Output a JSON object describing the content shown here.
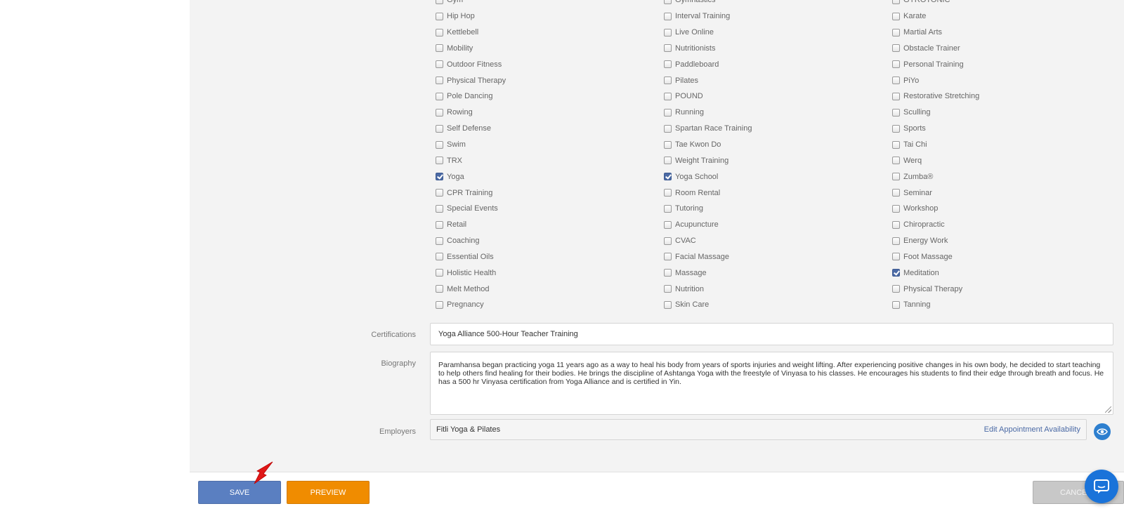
{
  "activities": [
    [
      {
        "label": "Gym",
        "checked": false
      },
      {
        "label": "Gymnastics",
        "checked": false
      },
      {
        "label": "GYROTONIC",
        "checked": false
      }
    ],
    [
      {
        "label": "Hip Hop",
        "checked": false
      },
      {
        "label": "Interval Training",
        "checked": false
      },
      {
        "label": "Karate",
        "checked": false
      }
    ],
    [
      {
        "label": "Kettlebell",
        "checked": false
      },
      {
        "label": "Live Online",
        "checked": false
      },
      {
        "label": "Martial Arts",
        "checked": false
      }
    ],
    [
      {
        "label": "Mobility",
        "checked": false
      },
      {
        "label": "Nutritionists",
        "checked": false
      },
      {
        "label": "Obstacle Trainer",
        "checked": false
      }
    ],
    [
      {
        "label": "Outdoor Fitness",
        "checked": false
      },
      {
        "label": "Paddleboard",
        "checked": false
      },
      {
        "label": "Personal Training",
        "checked": false
      }
    ],
    [
      {
        "label": "Physical Therapy",
        "checked": false
      },
      {
        "label": "Pilates",
        "checked": false
      },
      {
        "label": "PiYo",
        "checked": false
      }
    ],
    [
      {
        "label": "Pole Dancing",
        "checked": false
      },
      {
        "label": "POUND",
        "checked": false
      },
      {
        "label": "Restorative Stretching",
        "checked": false
      }
    ],
    [
      {
        "label": "Rowing",
        "checked": false
      },
      {
        "label": "Running",
        "checked": false
      },
      {
        "label": "Sculling",
        "checked": false
      }
    ],
    [
      {
        "label": "Self Defense",
        "checked": false
      },
      {
        "label": "Spartan Race Training",
        "checked": false
      },
      {
        "label": "Sports",
        "checked": false
      }
    ],
    [
      {
        "label": "Swim",
        "checked": false
      },
      {
        "label": "Tae Kwon Do",
        "checked": false
      },
      {
        "label": "Tai Chi",
        "checked": false
      }
    ],
    [
      {
        "label": "TRX",
        "checked": false
      },
      {
        "label": "Weight Training",
        "checked": false
      },
      {
        "label": "Werq",
        "checked": false
      }
    ],
    [
      {
        "label": "Yoga",
        "checked": true
      },
      {
        "label": "Yoga School",
        "checked": true
      },
      {
        "label": "Zumba®",
        "checked": false
      }
    ],
    [
      {
        "label": "CPR Training",
        "checked": false
      },
      {
        "label": "Room Rental",
        "checked": false
      },
      {
        "label": "Seminar",
        "checked": false
      }
    ],
    [
      {
        "label": "Special Events",
        "checked": false
      },
      {
        "label": "Tutoring",
        "checked": false
      },
      {
        "label": "Workshop",
        "checked": false
      }
    ],
    [
      {
        "label": "Retail",
        "checked": false
      },
      {
        "label": "Acupuncture",
        "checked": false
      },
      {
        "label": "Chiropractic",
        "checked": false
      }
    ],
    [
      {
        "label": "Coaching",
        "checked": false
      },
      {
        "label": "CVAC",
        "checked": false
      },
      {
        "label": "Energy Work",
        "checked": false
      }
    ],
    [
      {
        "label": "Essential Oils",
        "checked": false
      },
      {
        "label": "Facial Massage",
        "checked": false
      },
      {
        "label": "Foot Massage",
        "checked": false
      }
    ],
    [
      {
        "label": "Holistic Health",
        "checked": false
      },
      {
        "label": "Massage",
        "checked": false
      },
      {
        "label": "Meditation",
        "checked": true
      }
    ],
    [
      {
        "label": "Melt Method",
        "checked": false
      },
      {
        "label": "Nutrition",
        "checked": false
      },
      {
        "label": "Physical Therapy",
        "checked": false
      }
    ],
    [
      {
        "label": "Pregnancy",
        "checked": false
      },
      {
        "label": "Skin Care",
        "checked": false
      },
      {
        "label": "Tanning",
        "checked": false
      }
    ]
  ],
  "certifications": {
    "label": "Certifications",
    "value": "Yoga Alliance 500-Hour Teacher Training"
  },
  "biography": {
    "label": "Biography",
    "value": "Paramhansa began practicing yoga 11 years ago as a way to heal his body from years of sports injuries and weight lifting. After experiencing positive changes in his own body, he decided to start teaching to help others find healing for their bodies. He brings the discipline of Ashtanga Yoga with the freestyle of Vinyasa to his classes. He encourages his students to find their edge through breath and focus. He has a 500 hr Vinyasa certification from Yoga Alliance and is certified in Yin."
  },
  "employers": {
    "label": "Employers",
    "value": "Fitli Yoga & Pilates",
    "link": "Edit Appointment Availability"
  },
  "footer": {
    "save_label": "SAVE",
    "preview_label": "PREVIEW",
    "cancel_label": "CANCEL"
  },
  "colors": {
    "save": "#5a7fc1",
    "preview": "#f08c00",
    "checkbox_checked": "#4b6aa5",
    "chat": "#1a73d9"
  }
}
